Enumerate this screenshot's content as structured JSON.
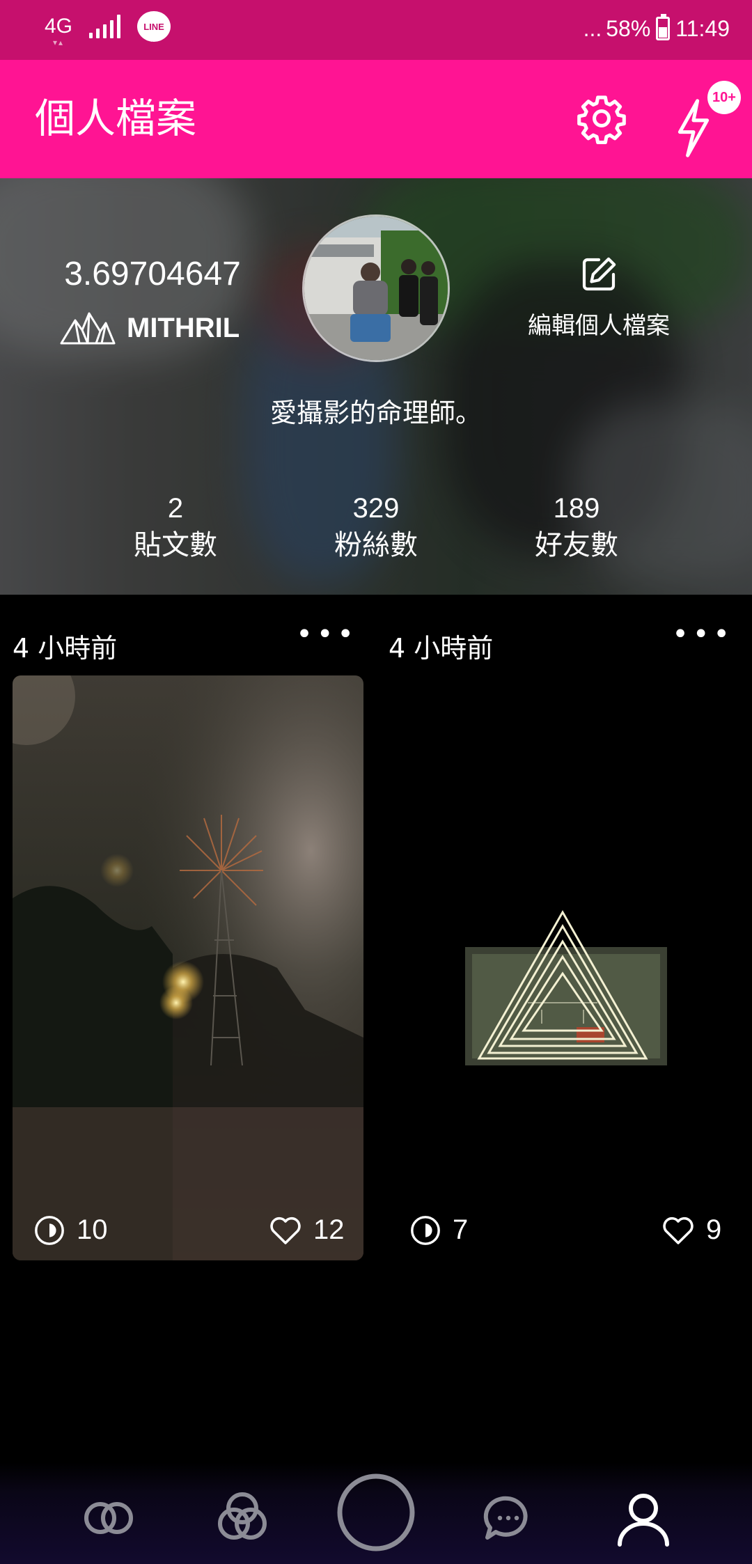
{
  "status_bar": {
    "network": "4G",
    "battery_percent": "58%",
    "dots": "...",
    "time": "11:49",
    "line_app_label": "LINE"
  },
  "app_bar": {
    "title": "個人檔案",
    "notification_badge": "10+"
  },
  "profile": {
    "balance": "3.69704647",
    "token_name": "MITHRIL",
    "edit_label": "編輯個人檔案",
    "bio": "愛攝影的命理師。",
    "stats": [
      {
        "value": "2",
        "label": "貼文數"
      },
      {
        "value": "329",
        "label": "粉絲數"
      },
      {
        "value": "189",
        "label": "好友數"
      }
    ]
  },
  "posts": [
    {
      "time": "4 小時前",
      "more": "•••",
      "views": "10",
      "likes": "12",
      "image": "night-windmill-photo"
    },
    {
      "time": "4 小時前",
      "more": "•••",
      "views": "7",
      "likes": "9",
      "image": "neon-triangle-photo"
    }
  ],
  "bottom_nav": {
    "items": [
      "circles-icon",
      "triple-circles-icon",
      "capture-ring-icon",
      "chat-bubble-icon",
      "profile-icon"
    ],
    "active": "profile-icon"
  },
  "colors": {
    "status_bar": "#c6106d",
    "app_bar": "#ff1493",
    "background": "#000000",
    "nav_inactive": "#8c8c96"
  }
}
